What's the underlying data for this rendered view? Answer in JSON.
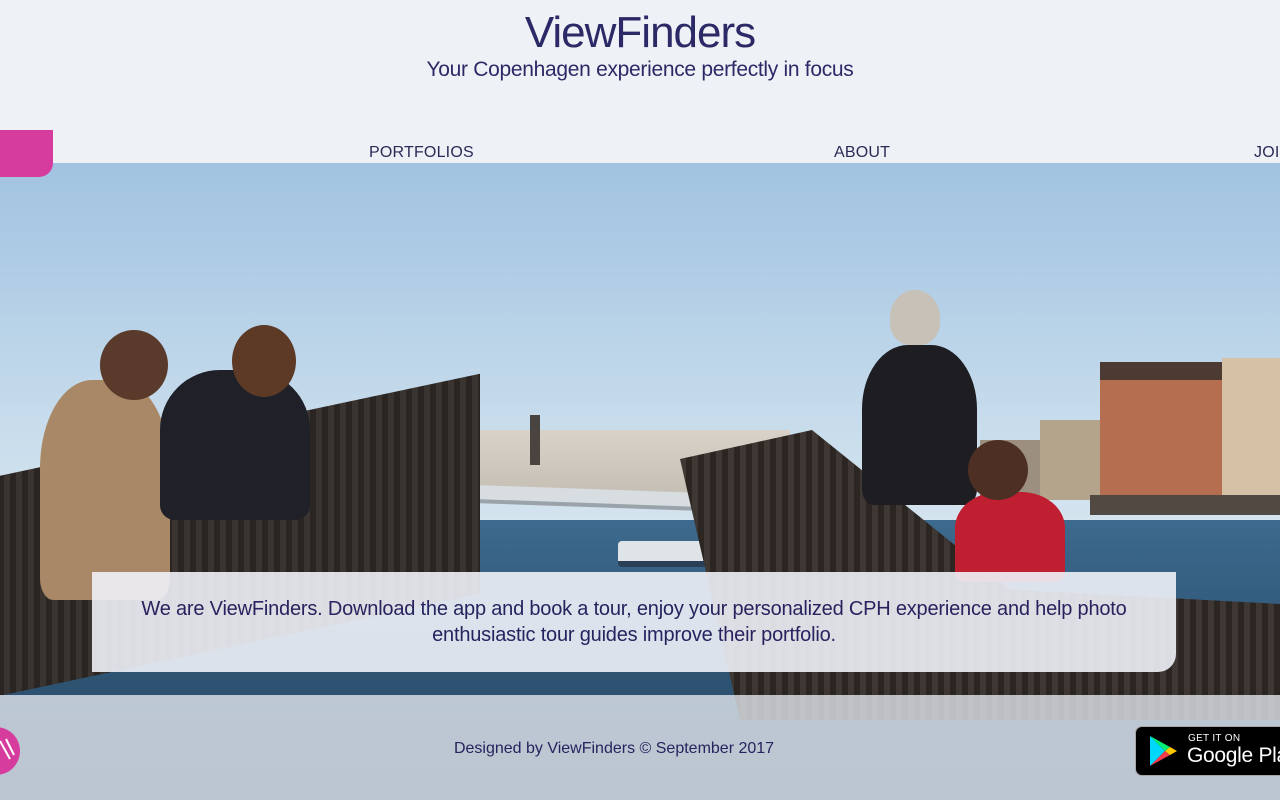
{
  "header": {
    "title": "ViewFinders",
    "subtitle": "Your Copenhagen experience perfectly in focus"
  },
  "nav": {
    "items": [
      {
        "label": "PORTFOLIOS"
      },
      {
        "label": "ABOUT"
      },
      {
        "label": "JOIN"
      }
    ]
  },
  "hero": {
    "description": "We are ViewFinders. Download the app and book a tour, enjoy your personalized CPH experience and help photo enthusiastic tour guides improve their portfolio."
  },
  "footer": {
    "credit": "Designed by ViewFinders © September 2017",
    "store_badge": {
      "small": "GET IT ON",
      "big": "Google Play"
    },
    "fab_icon": "pencil-icon"
  },
  "colors": {
    "brand_text": "#2c2a66",
    "accent_pink": "#d63c9e",
    "badge_black": "#000000"
  }
}
